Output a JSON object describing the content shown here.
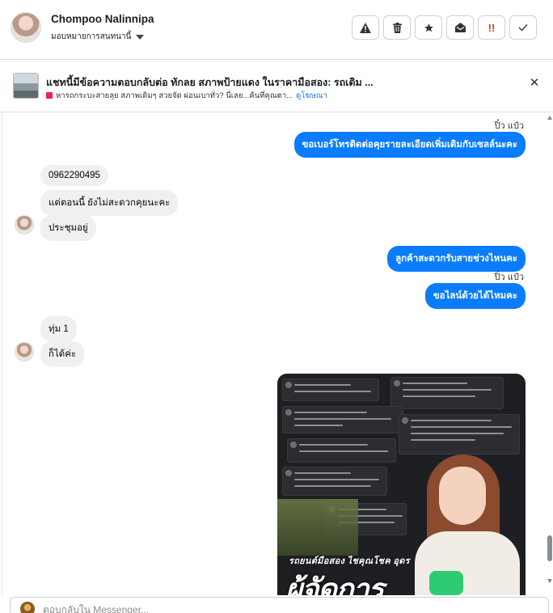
{
  "header": {
    "contact_name": "Chompoo Nalinnipa",
    "assign_label": "มอบหมายการสนทนานี้",
    "toolbar": [
      {
        "name": "spam-button",
        "icon": "⚠"
      },
      {
        "name": "delete-button",
        "icon": "🗑"
      },
      {
        "name": "star-button",
        "icon": "★"
      },
      {
        "name": "mark-unread-button",
        "icon": "✉"
      },
      {
        "name": "follow-up-button",
        "icon": "‼"
      },
      {
        "name": "done-button",
        "icon": "✓"
      }
    ]
  },
  "ad": {
    "title": "แชทนี้มีข้อความตอบกลับต่อ ทักลย สภาพป้ายแดง ในราคามือสอง: รถเดิม ...",
    "subtitle": "หารถกระบะสายลุย สภาพเดิมๆ สวยจัด ผ่อนเบาทั่ว? นี่เลย...ค้นที่คุณตา...",
    "link": "ดูโฆษณา",
    "close_icon": "✕"
  },
  "thread": {
    "seen_1": "ปิ๋ว แป๋ว",
    "out_1": "ขอเบอร์โทรติดต่อคุยรายละเอียดเพิ่มเติมกับเซลล์นะคะ",
    "in_1": "0962290495",
    "in_2": "แต่ตอนนี้ ยังไม่สะดวกคุยนะคะ",
    "in_3": "ประชุมอยู่",
    "out_2": "ลูกค้าสะดวกรับสายช่วงไหนคะ",
    "seen_2": "ปิ๋ว แป๋ว",
    "out_3": "ขอไลน์ด้วยได้ไหมคะ",
    "in_4": "ทุ่ม 1",
    "in_5": "ก็ได้ค่ะ",
    "image": {
      "caption_small": "รถยนต์มือสอง ไชคุณโชค อุดร",
      "caption_large": "ผู้จัดการ"
    }
  },
  "composer": {
    "placeholder": "ตอบกลับใน Messenger..."
  },
  "colors": {
    "outgoing_bubble": "#0a7cff",
    "incoming_bubble": "#f0f0f0",
    "link": "#1b74e4",
    "follow_up": "#d93025"
  }
}
